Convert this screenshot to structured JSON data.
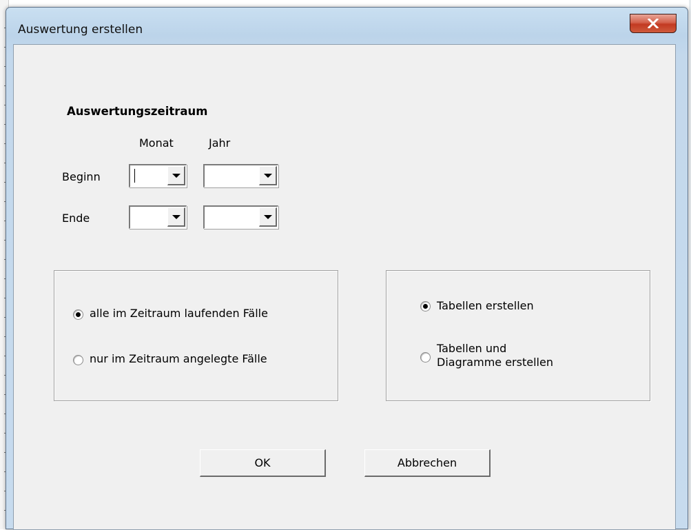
{
  "window": {
    "title": "Auswertung erstellen",
    "close_symbol": "X",
    "close_icon": "close-icon"
  },
  "period": {
    "heading": "Auswertungszeitraum",
    "col_month": "Monat",
    "col_year": "Jahr",
    "row_begin": "Beginn",
    "row_end": "Ende",
    "begin_month": "",
    "begin_year": "",
    "end_month": "",
    "end_year": ""
  },
  "case_scope": {
    "options": [
      {
        "label": "alle im Zeitraum laufenden Fälle",
        "checked": true
      },
      {
        "label": "nur im Zeitraum angelegte Fälle",
        "checked": false
      }
    ]
  },
  "output_mode": {
    "options": [
      {
        "label": "Tabellen erstellen",
        "checked": true
      },
      {
        "label_line1": "Tabellen und",
        "label_line2": "Diagramme erstellen",
        "checked": false
      }
    ]
  },
  "buttons": {
    "ok": "OK",
    "cancel": "Abbrechen"
  },
  "colors": {
    "close_button": "#c94a32",
    "window_frame": "#c3d8ec",
    "dialog_face": "#f0f0f0"
  }
}
